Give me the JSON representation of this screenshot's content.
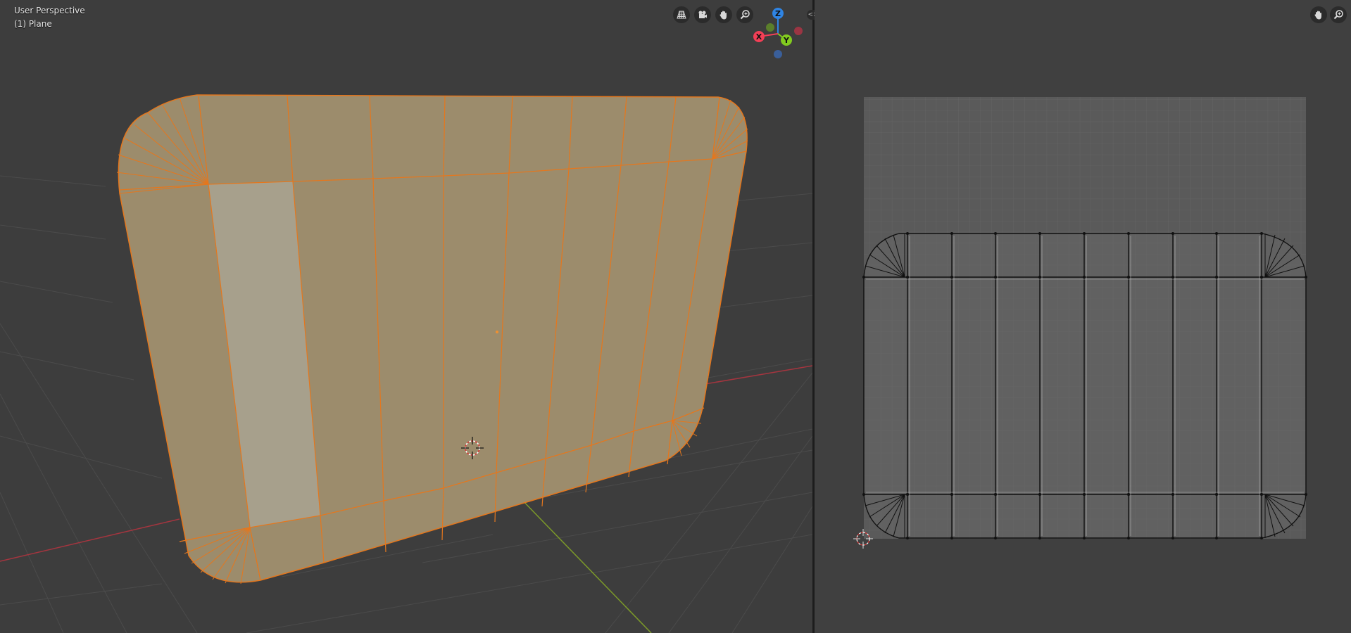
{
  "viewport3d": {
    "view_name": "User Perspective",
    "object_name": "(1) Plane",
    "nav_icons": [
      "toggle-grid-icon",
      "camera-view-icon",
      "pan-hand-icon",
      "zoom-icon"
    ],
    "gizmo_axes": {
      "x": "X",
      "y": "Y",
      "z": "Z"
    }
  },
  "uv_editor": {
    "nav_icons": [
      "pan-hand-icon",
      "zoom-icon"
    ]
  },
  "colors": {
    "mesh_face": "#9c8c6c",
    "mesh_edge": "#e5771d",
    "highlight_face": "#a8a290",
    "x_axis": "#f33f56",
    "y_axis": "#82cb1f",
    "z_axis": "#2f84e3",
    "uv_background": "#5a5a5a"
  }
}
